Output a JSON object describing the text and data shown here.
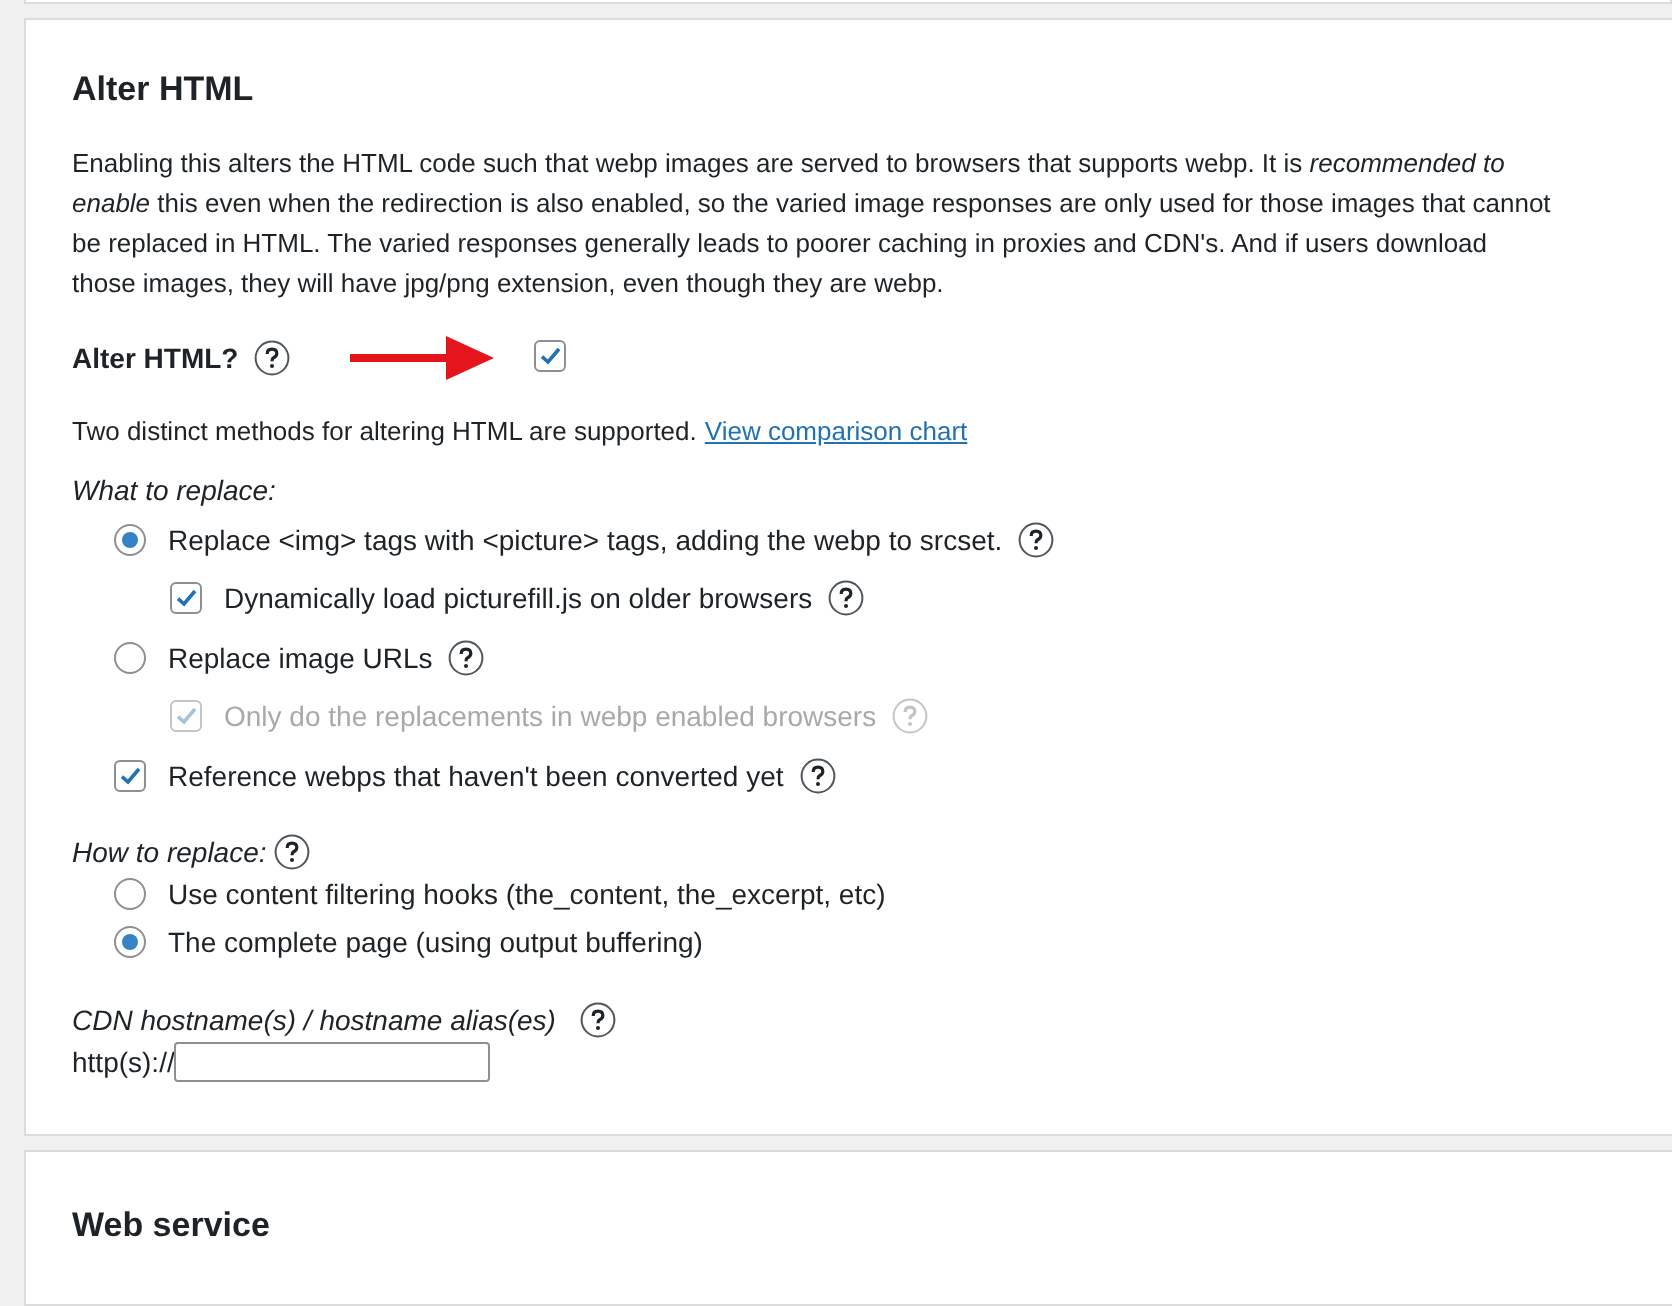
{
  "alter_html": {
    "title": "Alter HTML",
    "description": "Enabling this alters the HTML code such that webp images are served to browsers that supports webp. It is *recommended to enable* this even when the redirection is also enabled, so the varied image responses are only used for those images that cannot be replaced in HTML. The varied responses generally leads to poorer caching in proxies and CDN's. And if users download those images, they will have jpg/png extension, even though they are webp.",
    "toggle": {
      "label": "Alter HTML?",
      "help": true,
      "checked": true,
      "pointer_arrow": true
    },
    "methods_note": "Two distinct methods for altering HTML are supported.",
    "methods_link": "View comparison chart",
    "what_to_replace": {
      "label": "What to replace:",
      "options": [
        {
          "kind": "radio",
          "label": "Replace <img> tags with <picture> tags, adding the webp to srcset.",
          "selected": true,
          "disabled": false,
          "help": true,
          "children": [
            {
              "kind": "checkbox",
              "label": "Dynamically load picturefill.js on older browsers",
              "checked": true,
              "disabled": false,
              "help": true
            }
          ]
        },
        {
          "kind": "radio",
          "label": "Replace image URLs",
          "selected": false,
          "disabled": false,
          "help": true,
          "children": [
            {
              "kind": "checkbox",
              "label": "Only do the replacements in webp enabled browsers",
              "checked": true,
              "disabled": true,
              "help": true
            }
          ]
        },
        {
          "kind": "checkbox",
          "label": "Reference webps that haven't been converted yet",
          "checked": true,
          "disabled": false,
          "help": true
        }
      ]
    },
    "how_to_replace": {
      "label": "How to replace:",
      "help": true,
      "options": [
        {
          "label": "Use content filtering hooks (the_content, the_excerpt, etc)",
          "selected": false
        },
        {
          "label": "The complete page (using output buffering)",
          "selected": true
        }
      ]
    },
    "cdn": {
      "label": "CDN hostname(s) / hostname alias(es)",
      "help": true,
      "prefix": "http(s)://"
    }
  },
  "web_service": {
    "title": "Web service"
  }
}
